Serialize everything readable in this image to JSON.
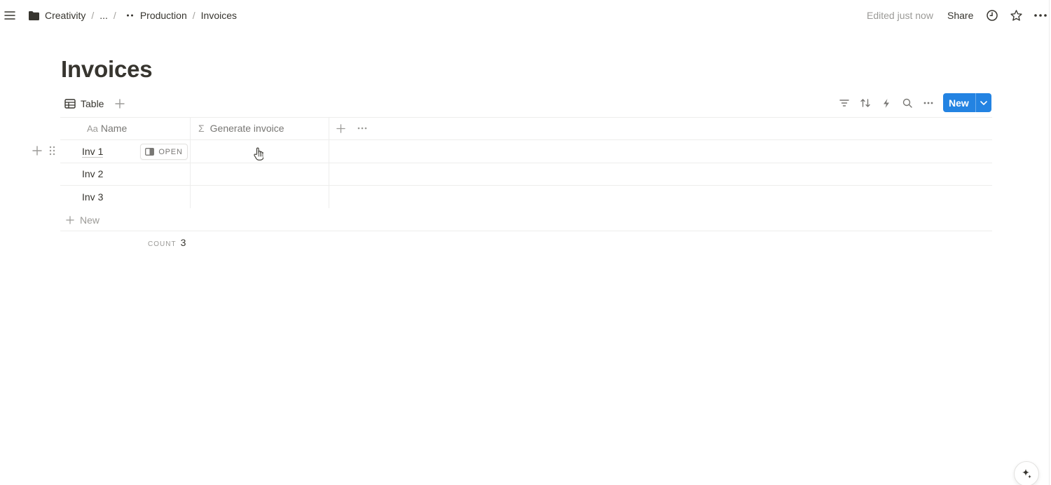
{
  "breadcrumb": {
    "items": [
      "Creativity",
      "...",
      "Production",
      "Invoices"
    ],
    "separator": "/"
  },
  "topbar": {
    "edited": "Edited just now",
    "share": "Share"
  },
  "page": {
    "title": "Invoices"
  },
  "view": {
    "tab_label": "Table",
    "new_label": "New"
  },
  "table": {
    "columns": [
      {
        "icon_text": "Aa",
        "label": "Name"
      },
      {
        "icon_text": "Σ",
        "label": "Generate invoice"
      }
    ],
    "rows": [
      {
        "name": "Inv 1"
      },
      {
        "name": "Inv 2"
      },
      {
        "name": "Inv 3"
      }
    ],
    "open_label": "OPEN",
    "add_row_label": "New",
    "count_label": "COUNT",
    "count_value": "3"
  },
  "colors": {
    "accent": "#2383e2",
    "text": "#37352f",
    "muted": "#9b9a97",
    "border": "#ededec"
  }
}
